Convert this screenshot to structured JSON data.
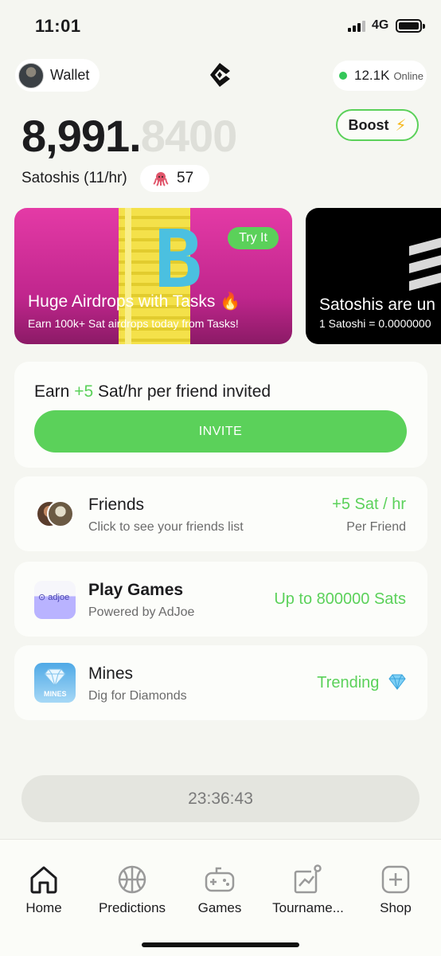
{
  "status": {
    "time": "11:01",
    "network": "4G"
  },
  "header": {
    "wallet_label": "Wallet",
    "online_count": "12.1K",
    "online_label": "Online"
  },
  "balance": {
    "whole": "8,991.",
    "fraction": "8400",
    "rate_label": "Satoshis (11/hr)",
    "referrals": "57"
  },
  "boost": {
    "label": "Boost",
    "icon": "lightning-icon"
  },
  "banners": [
    {
      "title": "Huge Airdrops with Tasks 🔥",
      "subtitle": "Earn 100k+ Sat airdrops today from Tasks!",
      "cta": "Try It"
    },
    {
      "title": "Satoshis are un",
      "subtitle": "1 Satoshi = 0.0000000"
    }
  ],
  "invite": {
    "prefix": "Earn ",
    "bonus": "+5",
    "suffix": " Sat/hr per friend invited",
    "button": "INVITE"
  },
  "friends": {
    "title": "Friends",
    "subtitle": "Click to see your friends list",
    "reward": "+5 Sat / hr",
    "reward_sub": "Per Friend"
  },
  "games": {
    "title": "Play Games",
    "subtitle": "Powered by AdJoe",
    "reward": "Up to 800000 Sats",
    "icon_text": "⊙ adjoe"
  },
  "mines": {
    "title": "Mines",
    "subtitle": "Dig for Diamonds",
    "tag": "Trending",
    "icon_text": "MINES"
  },
  "timer": "23:36:43",
  "tabs": [
    {
      "label": "Home",
      "icon": "home-icon"
    },
    {
      "label": "Predictions",
      "icon": "basketball-icon"
    },
    {
      "label": "Games",
      "icon": "gamepad-icon"
    },
    {
      "label": "Tourname...",
      "icon": "chart-icon"
    },
    {
      "label": "Shop",
      "icon": "plus-square-icon"
    }
  ],
  "colors": {
    "accent": "#5bd15a",
    "background": "#f5f6f1",
    "banner_pink": "#d32f9a"
  }
}
